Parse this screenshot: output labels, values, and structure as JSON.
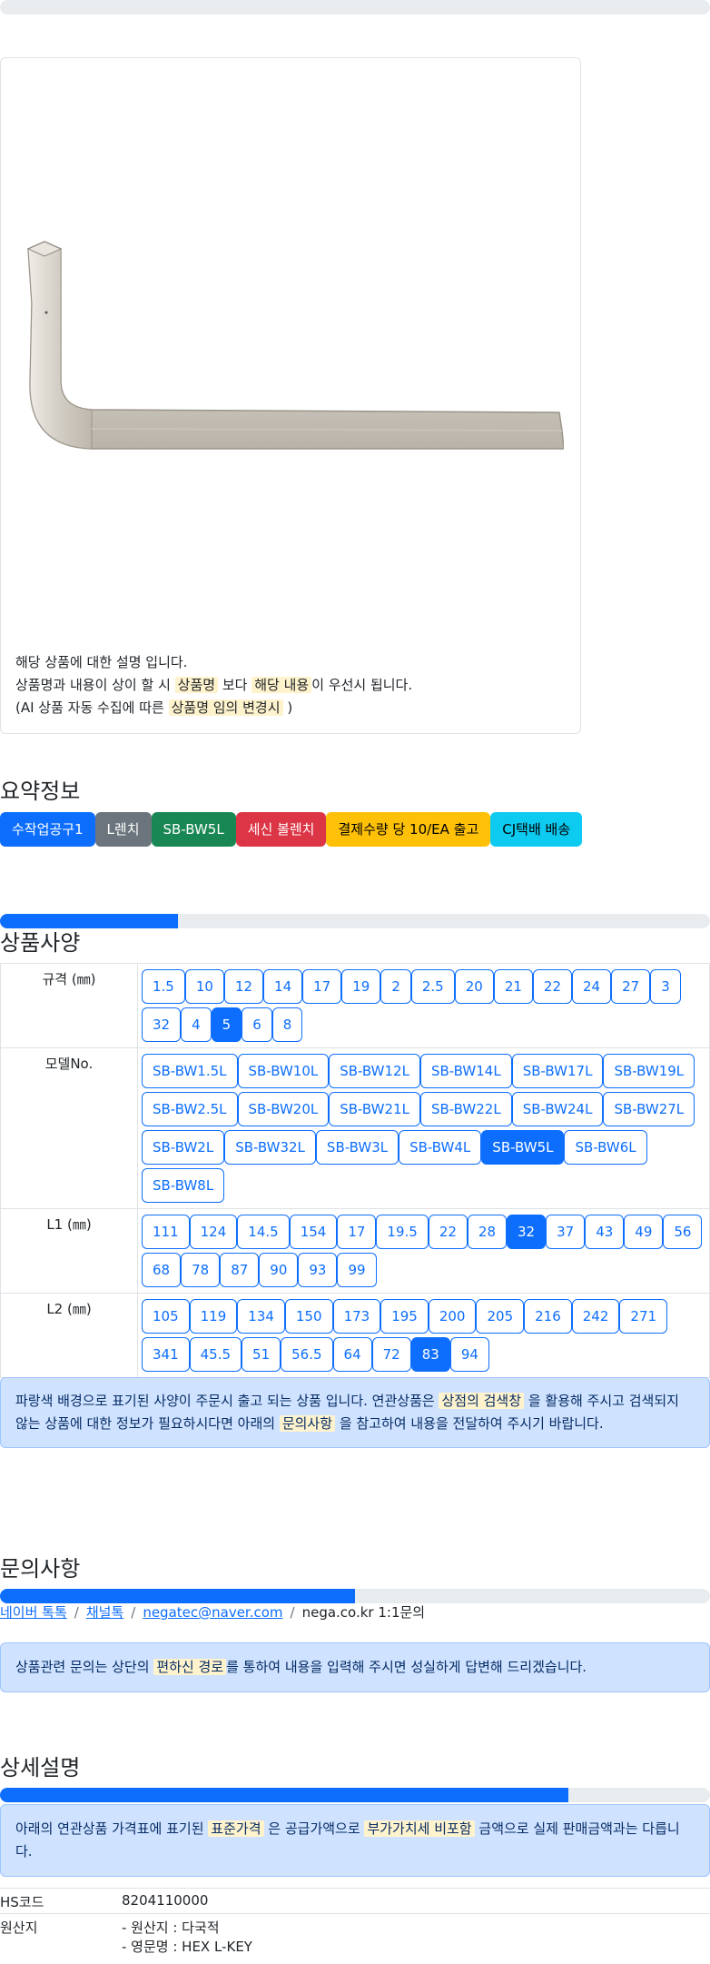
{
  "notes": {
    "line1": "해당 상품에 대한 설명 입니다.",
    "line2_pre": "상품명과 내용이 상이 할 시",
    "line2_hl1": "상품명",
    "line2_mid": "보다",
    "line2_hl2": "해당 내용",
    "line2_post": "이 우선시 됩니다.",
    "line3_pre": "(AI 상품 자동 수집에 따른",
    "line3_hl": "상품명 임의 변경시",
    "line3_post": ")"
  },
  "summary": {
    "title": "요약정보",
    "badges": [
      "수작업공구1",
      "L렌치",
      "SB-BW5L",
      "세신 볼렌치",
      "결제수량 당 10/EA 출고",
      "CJ택배 배송"
    ]
  },
  "progress": {
    "spec": 0.25,
    "inquiry": 0.5,
    "detail": 0.8
  },
  "spec": {
    "title": "상품사양",
    "rows": [
      {
        "label": "규격 (㎜)",
        "options": [
          "1.5",
          "10",
          "12",
          "14",
          "17",
          "19",
          "2",
          "2.5",
          "20",
          "21",
          "22",
          "24",
          "27",
          "3",
          "32",
          "4",
          "5",
          "6",
          "8"
        ],
        "selected": "5"
      },
      {
        "label": "모델No.",
        "options": [
          "SB-BW1.5L",
          "SB-BW10L",
          "SB-BW12L",
          "SB-BW14L",
          "SB-BW17L",
          "SB-BW19L",
          "SB-BW2.5L",
          "SB-BW20L",
          "SB-BW21L",
          "SB-BW22L",
          "SB-BW24L",
          "SB-BW27L",
          "SB-BW2L",
          "SB-BW32L",
          "SB-BW3L",
          "SB-BW4L",
          "SB-BW5L",
          "SB-BW6L",
          "SB-BW8L"
        ],
        "selected": "SB-BW5L"
      },
      {
        "label": "L1 (㎜)",
        "options": [
          "111",
          "124",
          "14.5",
          "154",
          "17",
          "19.5",
          "22",
          "28",
          "32",
          "37",
          "43",
          "49",
          "56",
          "68",
          "78",
          "87",
          "90",
          "93",
          "99"
        ],
        "selected": "32"
      },
      {
        "label": "L2 (㎜)",
        "options": [
          "105",
          "119",
          "134",
          "150",
          "173",
          "195",
          "200",
          "205",
          "216",
          "242",
          "271",
          "341",
          "45.5",
          "51",
          "56.5",
          "64",
          "72",
          "83",
          "94"
        ],
        "selected": "83"
      }
    ],
    "alert_pre": "파랑색 배경으로 표기된 사양이 주문시 출고 되는 상품 입니다. 연관상품은",
    "alert_hl1": "상점의 검색창",
    "alert_mid": "을 활용해 주시고 검색되지 않는 상품에 대한 정보가 필요하시다면 아래의",
    "alert_hl2": "문의사항",
    "alert_post": "을 참고하여 내용을 전달하여 주시기 바랍니다."
  },
  "inquiry": {
    "title": "문의사항",
    "links": [
      "네이버 톡톡",
      "채널톡",
      "negatec@naver.com"
    ],
    "last": "nega.co.kr 1:1문의",
    "sep": "/",
    "alert_pre": "상품관련 문의는 상단의",
    "alert_hl": "편하신 경로",
    "alert_post": "를 통하여 내용을 입력해 주시면 성실하게 답변해 드리겠습니다."
  },
  "detail": {
    "title": "상세설명",
    "alert_pre": "아래의 연관상품 가격표에 표기된",
    "alert_hl1": "표준가격",
    "alert_mid": "은 공급가액으로",
    "alert_hl2": "부가가치세 비포함",
    "alert_post": "금액으로 실제 판매금액과는 다릅니다.",
    "hs_label": "HS코드",
    "hs_value": "8204110000",
    "origin_label": "원산지",
    "origin_line1": "- 원산지 : 다국적",
    "origin_line2": "- 영문명 : HEX L-KEY"
  }
}
